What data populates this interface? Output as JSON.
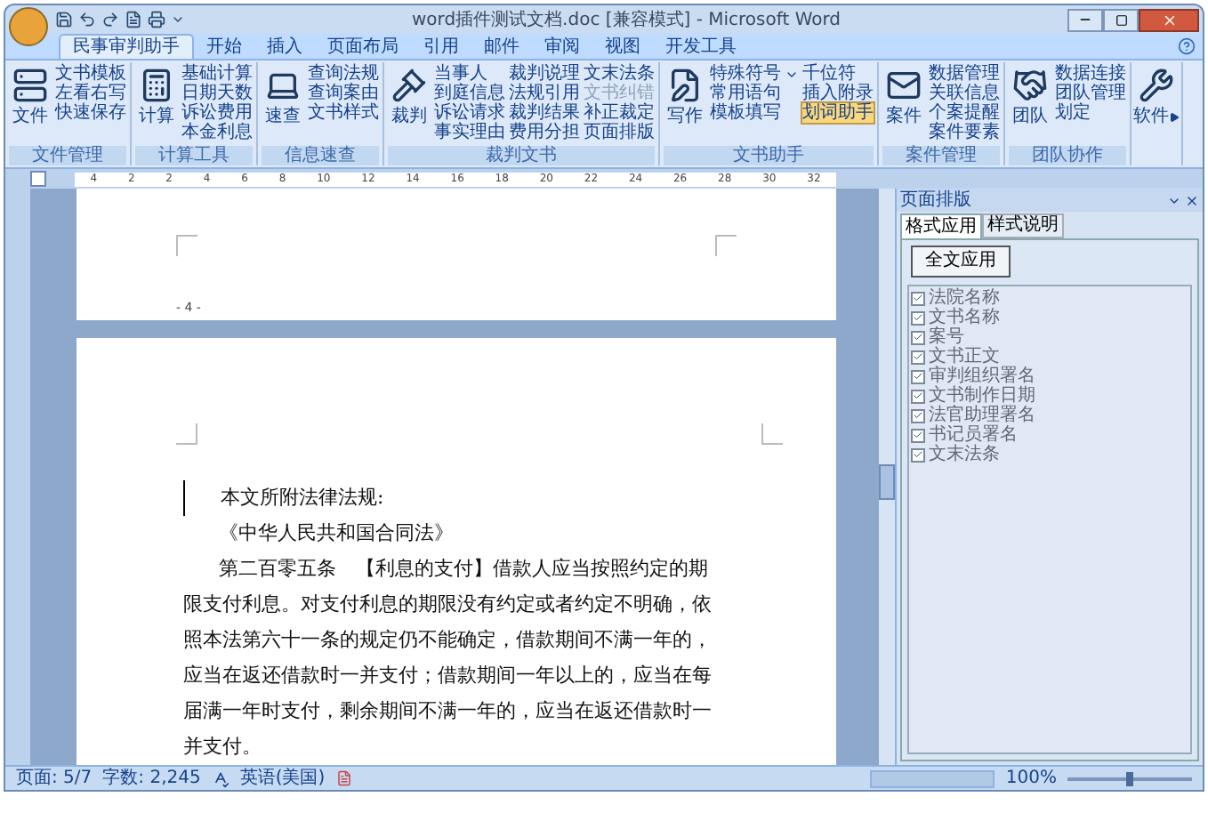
{
  "window": {
    "title": "word插件测试文档.doc [兼容模式] - Microsoft Word"
  },
  "tabs": [
    {
      "label": "民事审判助手",
      "selected": true
    },
    {
      "label": "开始",
      "selected": false
    },
    {
      "label": "插入",
      "selected": false
    },
    {
      "label": "页面布局",
      "selected": false
    },
    {
      "label": "引用",
      "selected": false
    },
    {
      "label": "邮件",
      "selected": false
    },
    {
      "label": "审阅",
      "selected": false
    },
    {
      "label": "视图",
      "selected": false
    },
    {
      "label": "开发工具",
      "selected": false
    }
  ],
  "ribbon_groups": [
    {
      "label": "文件管理",
      "big": {
        "label": "文件"
      },
      "items": [
        {
          "label": "文书模板"
        },
        {
          "label": "左看右写"
        },
        {
          "label": "快速保存"
        }
      ]
    },
    {
      "label": "计算工具",
      "big": {
        "label": "计算"
      },
      "items": [
        {
          "label": "基础计算"
        },
        {
          "label": "日期天数"
        },
        {
          "label": "诉讼费用"
        },
        {
          "label": "本金利息"
        }
      ]
    },
    {
      "label": "信息速查",
      "big": {
        "label": "速查"
      },
      "items": [
        {
          "label": "查询法规"
        },
        {
          "label": "查询案由"
        },
        {
          "label": "文书样式"
        }
      ]
    },
    {
      "label": "裁判文书",
      "big": {
        "label": "裁判"
      },
      "items": [
        {
          "label": "当事人"
        },
        {
          "label": "到庭信息"
        },
        {
          "label": "诉讼请求"
        },
        {
          "label": "事实理由"
        },
        {
          "label": "裁判说理"
        },
        {
          "label": "法规引用"
        },
        {
          "label": "裁判结果"
        },
        {
          "label": "费用分担"
        },
        {
          "label": "文末法条"
        },
        {
          "label": "文书纠错",
          "disabled": true
        },
        {
          "label": "补正裁定"
        },
        {
          "label": "页面排版"
        }
      ]
    },
    {
      "label": "文书助手",
      "big": {
        "label": "写作"
      },
      "items": [
        {
          "label": "特殊符号",
          "dropdown": true
        },
        {
          "label": "常用语句"
        },
        {
          "label": "模板填写"
        },
        {
          "label": "千位符"
        },
        {
          "label": "插入附录"
        },
        {
          "label": "划词助手",
          "selected": true
        }
      ]
    },
    {
      "label": "案件管理",
      "big": {
        "label": "案件"
      },
      "items": [
        {
          "label": "数据管理"
        },
        {
          "label": "关联信息"
        },
        {
          "label": "个案提醒"
        },
        {
          "label": "案件要素"
        }
      ]
    },
    {
      "label": "团队协作",
      "big": {
        "label": "团队"
      },
      "items": [
        {
          "label": "数据连接"
        },
        {
          "label": "团队管理"
        },
        {
          "label": "划定"
        }
      ]
    },
    {
      "big": {
        "label": "软件",
        "dropdown": true
      }
    }
  ],
  "ruler": [
    "4",
    "2",
    "2",
    "4",
    "6",
    "8",
    "10",
    "12",
    "14",
    "16",
    "18",
    "20",
    "22",
    "24",
    "26",
    "28",
    "30",
    "32"
  ],
  "document": {
    "footer": "- 4 -",
    "paragraphs": [
      "本文所附法律法规:",
      "《中华人民共和国合同法》",
      "第二百零五条　【利息的支付】借款人应当按照约定的期限支付利息。对支付利息的期限没有约定或者约定不明确，依照本法第六十一条的规定仍不能确定，借款期间不满一年的，应当在返还借款时一并支付；借款期间一年以上的，应当在每届满一年时支付，剩余期间不满一年的，应当在返还借款时一并支付。"
    ]
  },
  "pane": {
    "title": "页面排版",
    "tabs": [
      {
        "label": "格式应用",
        "selected": true
      },
      {
        "label": "样式说明",
        "selected": false
      }
    ],
    "button": "全文应用",
    "items": [
      {
        "label": "法院名称",
        "checked": true
      },
      {
        "label": "文书名称",
        "checked": true
      },
      {
        "label": "案号",
        "checked": true
      },
      {
        "label": "文书正文",
        "checked": true
      },
      {
        "label": "审判组织署名",
        "checked": true
      },
      {
        "label": "文书制作日期",
        "checked": true
      },
      {
        "label": "法官助理署名",
        "checked": true
      },
      {
        "label": "书记员署名",
        "checked": true
      },
      {
        "label": "文末法条",
        "checked": true
      }
    ]
  },
  "status_bar": {
    "page": "页面: 5/7",
    "words": "字数: 2,245",
    "language": "英语(美国)",
    "zoom": "100%",
    "zoom_level": {
      "level": 0.5
    }
  }
}
